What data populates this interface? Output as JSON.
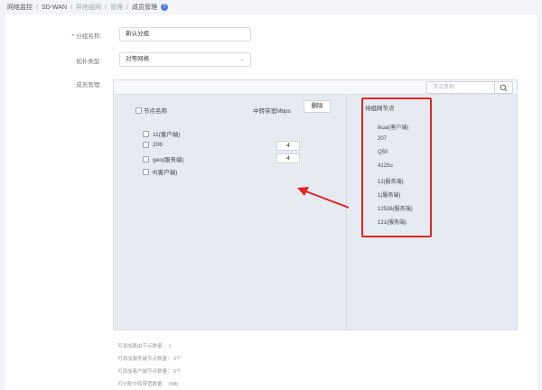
{
  "breadcrumb": {
    "items": [
      "网络监控",
      "SD-WAN",
      "异地组网",
      "管理",
      "成员管理"
    ]
  },
  "form": {
    "group_name_label": "分组名称:",
    "group_name_value": "新认分组",
    "topology_label": "拓扑类型:",
    "topology_value": "对等网络",
    "member_label": "成员管理:"
  },
  "member": {
    "search_placeholder": "节点名称",
    "node_header": "节点名称",
    "relay_header": "中转带宽Mbps",
    "delete_label": "删除",
    "nodes": [
      {
        "name": "11(客户端)",
        "bandwidth": ""
      },
      {
        "name": "206",
        "bandwidth": "4"
      },
      {
        "name": "geo(服务端)",
        "bandwidth": "4"
      },
      {
        "name": "tf(客户端)",
        "bandwidth": ""
      }
    ],
    "pending_title": "待组网节点",
    "pending_nodes": [
      "ikuai(客户端)",
      "207",
      "Q50",
      "4125u",
      "12(服务端)",
      "1(服务端)",
      "12536(服务端)",
      "121(服务端)"
    ]
  },
  "stats": [
    "可添加路由节点数量： 1",
    "可添加服务端节点数量： 0个",
    "可添加客户端节点数量： 0个",
    "可分配中转带宽数量： 0Mb"
  ],
  "colors": {
    "highlight": "#e02525",
    "accent": "#4a7bd8"
  }
}
